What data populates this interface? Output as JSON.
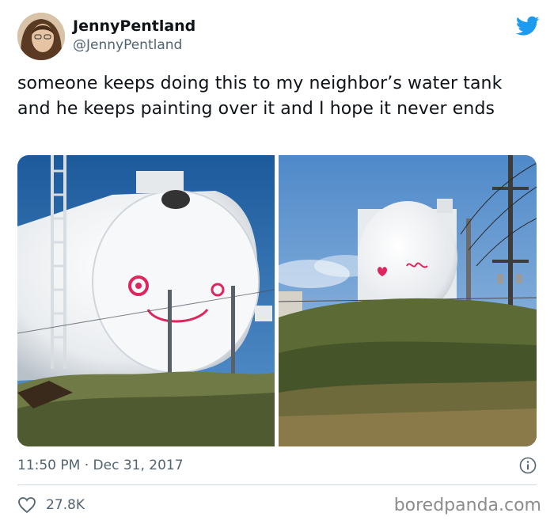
{
  "author": {
    "display_name": "JennyPentland",
    "handle": "@JennyPentland",
    "avatar_icon": "avatar-photo"
  },
  "brand_icon": "twitter-bird-icon",
  "brand_color": "#1d9bf0",
  "tweet": {
    "text": "someone keeps doing this to my neighbor’s water tank and he keeps painting over it and I hope it never ends"
  },
  "media": [
    {
      "name": "water-tank-closeup-photo"
    },
    {
      "name": "water-tank-distance-photo"
    }
  ],
  "meta": {
    "time": "11:50 PM",
    "separator": "·",
    "date": "Dec 31, 2017",
    "info_icon": "info-icon"
  },
  "stats": {
    "likes": "27.8K",
    "like_icon": "heart-icon"
  },
  "watermark": "boredpanda.com"
}
